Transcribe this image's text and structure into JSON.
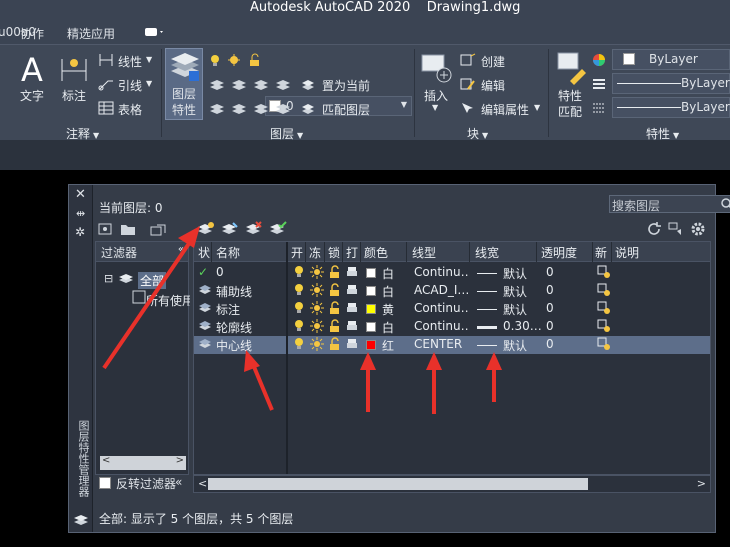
{
  "app": {
    "title": "Autodesk AutoCAD 2020",
    "document": "Drawing1.dwg"
  },
  "menu_tabs": [
    "协作",
    "精选应用"
  ],
  "ribbon": {
    "annotation": {
      "panel_title": "注释",
      "text_label": "文字",
      "dim_label": "标注",
      "linear_label": "线性",
      "leader_label": "引线",
      "table_label": "表格"
    },
    "layers": {
      "panel_title": "图层",
      "layer_props_label_1": "图层",
      "layer_props_label_2": "特性",
      "current_layer_value": "0",
      "set_current_label": "置为当前",
      "match_layer_label": "匹配图层"
    },
    "block": {
      "panel_title": "块",
      "insert_label": "插入",
      "create_label": "创建",
      "edit_label": "编辑",
      "edit_attr_label": "编辑属性"
    },
    "properties": {
      "panel_title": "特性",
      "match_label_1": "特性",
      "match_label_2": "匹配",
      "color_value": "ByLayer",
      "linetype_value": "ByLayer",
      "lineweight_value": "ByLayer"
    }
  },
  "palette": {
    "side_title": "图层特性管理器",
    "current_layer": "当前图层: 0",
    "search_placeholder": "搜索图层",
    "filter_header": "过滤器",
    "filter_all": "全部",
    "filter_used": "所有使用的图层",
    "invert_label": "反转过滤器",
    "columns": [
      "状",
      "名称",
      "开",
      "冻",
      "锁",
      "打",
      "颜色",
      "线型",
      "线宽",
      "透明度",
      "新",
      "说明"
    ],
    "layers": [
      {
        "name": "0",
        "color_name": "白",
        "color_hex": "#ffffff",
        "linetype": "Continu…",
        "lineweight": "默认",
        "transparency": "0",
        "current": true
      },
      {
        "name": "辅助线",
        "color_name": "白",
        "color_hex": "#ffffff",
        "linetype": "ACAD_I…",
        "lineweight": "默认",
        "transparency": "0",
        "current": false
      },
      {
        "name": "标注",
        "color_name": "黄",
        "color_hex": "#ffff00",
        "linetype": "Continu…",
        "lineweight": "默认",
        "transparency": "0",
        "current": false
      },
      {
        "name": "轮廓线",
        "color_name": "白",
        "color_hex": "#ffffff",
        "linetype": "Continu…",
        "lineweight": "0.30…",
        "transparency": "0",
        "current": false
      },
      {
        "name": "中心线",
        "color_name": "红",
        "color_hex": "#ff0000",
        "linetype": "CENTER",
        "lineweight": "默认",
        "transparency": "0",
        "current": false,
        "selected": true
      }
    ],
    "status": "全部: 显示了 5 个图层，共 5 个图层"
  },
  "colors": {
    "annotation_arrow": "#e8312a",
    "selection": "#5d6e8a"
  }
}
